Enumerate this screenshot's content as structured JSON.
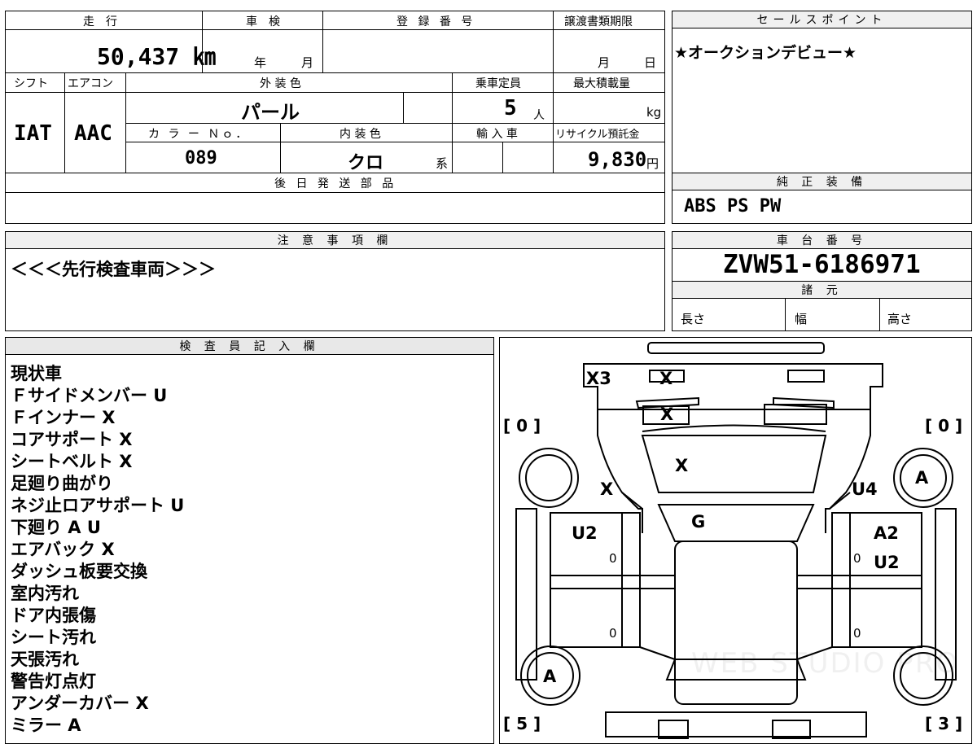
{
  "top": {
    "mileage_label": "走　行",
    "mileage": "50,437 ㎞",
    "inspection_label": "車　検",
    "year_unit": "年",
    "month_unit": "月",
    "registration_label": "登 録 番 号",
    "transfer_label": "譲渡書類期限",
    "day_unit": "日",
    "shift_label": "シフト",
    "ac_label": "エアコン",
    "exterior_color_label": "外 装 色",
    "capacity_label": "乗車定員",
    "max_load_label": "最大積載量",
    "shift": "IAT",
    "ac": "AAC",
    "exterior_color": "パール",
    "capacity": "5",
    "capacity_unit": "人",
    "load_unit": "kg",
    "color_no_label": "カ ラ ー Ｎｏ．",
    "interior_color_label": "内 装 色",
    "import_label": "輸 入 車",
    "recycle_label": "リサイクル預託金",
    "color_no": "089",
    "interior_color": "クロ",
    "interior_suffix": "系",
    "recycle_fee": "9,830",
    "yen": "円",
    "later_parts_label": "後 日 発 送 部 品"
  },
  "sales": {
    "label": "セールスポイント",
    "text": "★オークションデビュー★"
  },
  "equipment": {
    "label": "純 正 装 備",
    "text": "ABS PS PW"
  },
  "notes": {
    "label": "注 意 事 項 欄",
    "text": "＜＜＜先行検査車両＞＞＞"
  },
  "chassis": {
    "label": "車 台 番 号",
    "number": "ZVW51-6186971",
    "specs_label": "諸 元",
    "length": "長さ",
    "width": "幅",
    "height": "高さ"
  },
  "inspector": {
    "label": "検 査 員 記 入 欄",
    "lines": [
      "現状車",
      "Ｆサイドメンバー U",
      "Ｆインナー X",
      "コアサポート X",
      "シートベルト X",
      "足廻り曲がり",
      "ネジ止ロアサポート U",
      "下廻り A U",
      "エアバック X",
      "ダッシュ板要交換",
      "室内汚れ",
      "ドア内張傷",
      "シート汚れ",
      "天張汚れ",
      "警告灯点灯",
      "アンダーカバー X",
      "ミラー A"
    ]
  },
  "diagram": {
    "tire_fl": "[ 0 ]",
    "tire_fr": "[ 0 ]",
    "tire_rl": "[ 5 ]",
    "tire_rr": "[ 3 ]",
    "marks": [
      "X3",
      "X",
      "X",
      "X",
      "X",
      "U4",
      "A",
      "G",
      "U2",
      "A2",
      "U2",
      "0",
      "0",
      "0",
      "0",
      "A"
    ],
    "watermark": "WEB STUDIO PRO"
  }
}
